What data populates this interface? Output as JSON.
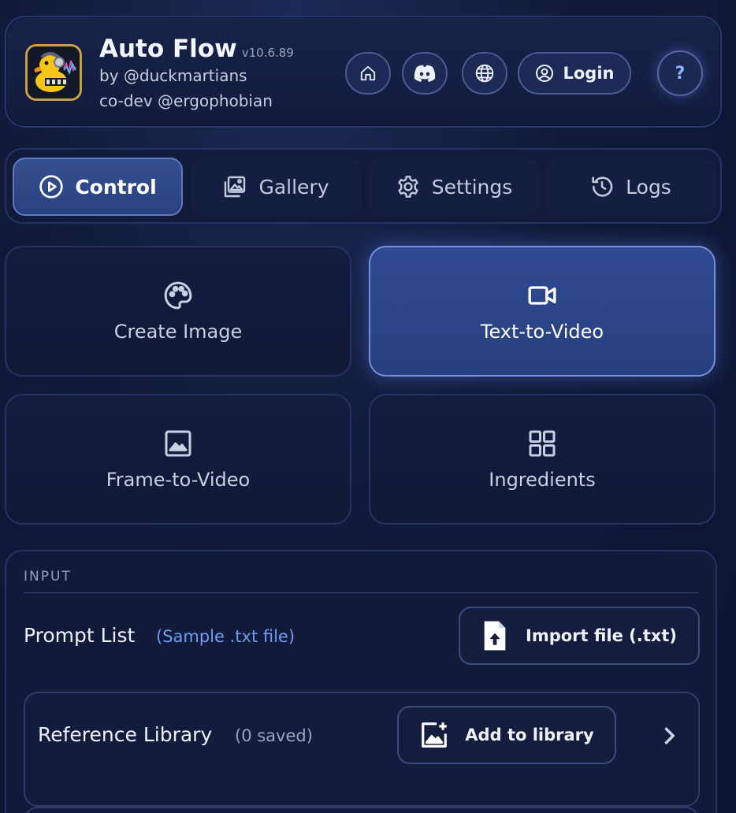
{
  "header": {
    "app_name": "Auto Flow",
    "version": "v10.6.89",
    "by_line": "by @duckmartians",
    "codev_line": "co-dev @ergophobian",
    "login_label": "Login",
    "help_label": "?",
    "icons": [
      "home-icon",
      "discord-icon",
      "globe-icon",
      "user-circle-icon"
    ]
  },
  "tabs": [
    {
      "label": "Control",
      "icon": "play-circle-icon",
      "active": true
    },
    {
      "label": "Gallery",
      "icon": "gallery-icon",
      "active": false
    },
    {
      "label": "Settings",
      "icon": "gear-icon",
      "active": false
    },
    {
      "label": "Logs",
      "icon": "history-icon",
      "active": false
    }
  ],
  "modes": [
    {
      "label": "Create Image",
      "icon": "palette-icon",
      "active": false
    },
    {
      "label": "Text-to-Video",
      "icon": "video-camera-icon",
      "active": true
    },
    {
      "label": "Frame-to-Video",
      "icon": "image-icon",
      "active": false
    },
    {
      "label": "Ingredients",
      "icon": "grid-icon",
      "active": false
    }
  ],
  "input": {
    "section_label": "INPUT",
    "prompt_list_label": "Prompt List",
    "sample_link": "(Sample .txt file)",
    "import_label": "Import file (.txt)",
    "reference_library_label": "Reference Library",
    "reference_count": "(0 saved)",
    "add_library_label": "Add to library"
  },
  "colors": {
    "background": "#0d1530",
    "active_tab": "#34508f",
    "accent_link": "#6f9cf5",
    "logo_border": "#c7a04a"
  }
}
